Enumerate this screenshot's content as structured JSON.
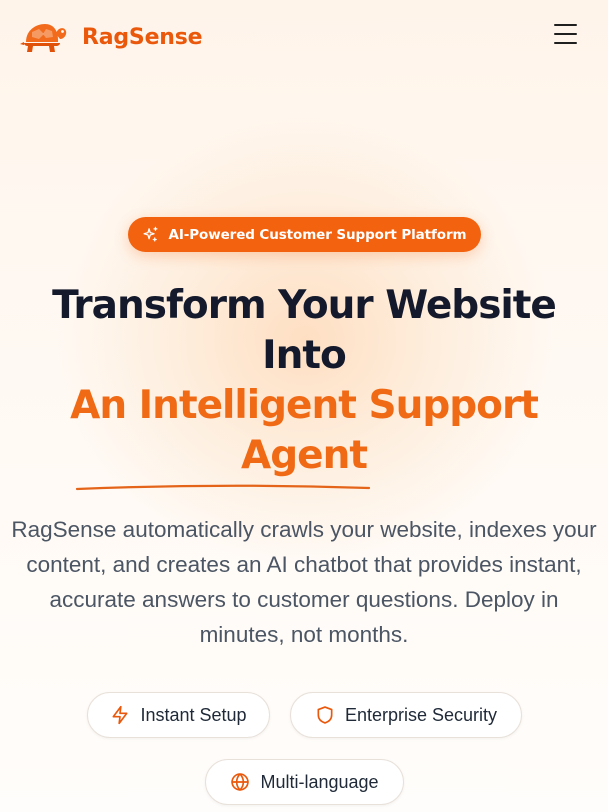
{
  "header": {
    "brand": "RagSense",
    "logo_icon": "turtle-logo-icon",
    "menu_icon": "hamburger-menu-icon"
  },
  "hero": {
    "badge": {
      "icon": "sparkles-icon",
      "label": "AI-Powered Customer Support Platform"
    },
    "headline": {
      "line1": "Transform Your Website",
      "line2": "Into",
      "accent_line1": "An Intelligent Support",
      "accent_line2": "Agent"
    },
    "description": "RagSense automatically crawls your website, indexes your content, and creates an AI chatbot that provides instant, accurate answers to customer questions. Deploy in minutes, not months.",
    "features": [
      {
        "icon": "lightning-icon",
        "label": "Instant Setup"
      },
      {
        "icon": "shield-icon",
        "label": "Enterprise Security"
      },
      {
        "icon": "globe-icon",
        "label": "Multi-language"
      }
    ]
  },
  "colors": {
    "brand": "#ea580c",
    "accent": "#f06a15",
    "heading": "#141a2b",
    "body_text": "#4b5563",
    "background": "#fffbf6"
  }
}
